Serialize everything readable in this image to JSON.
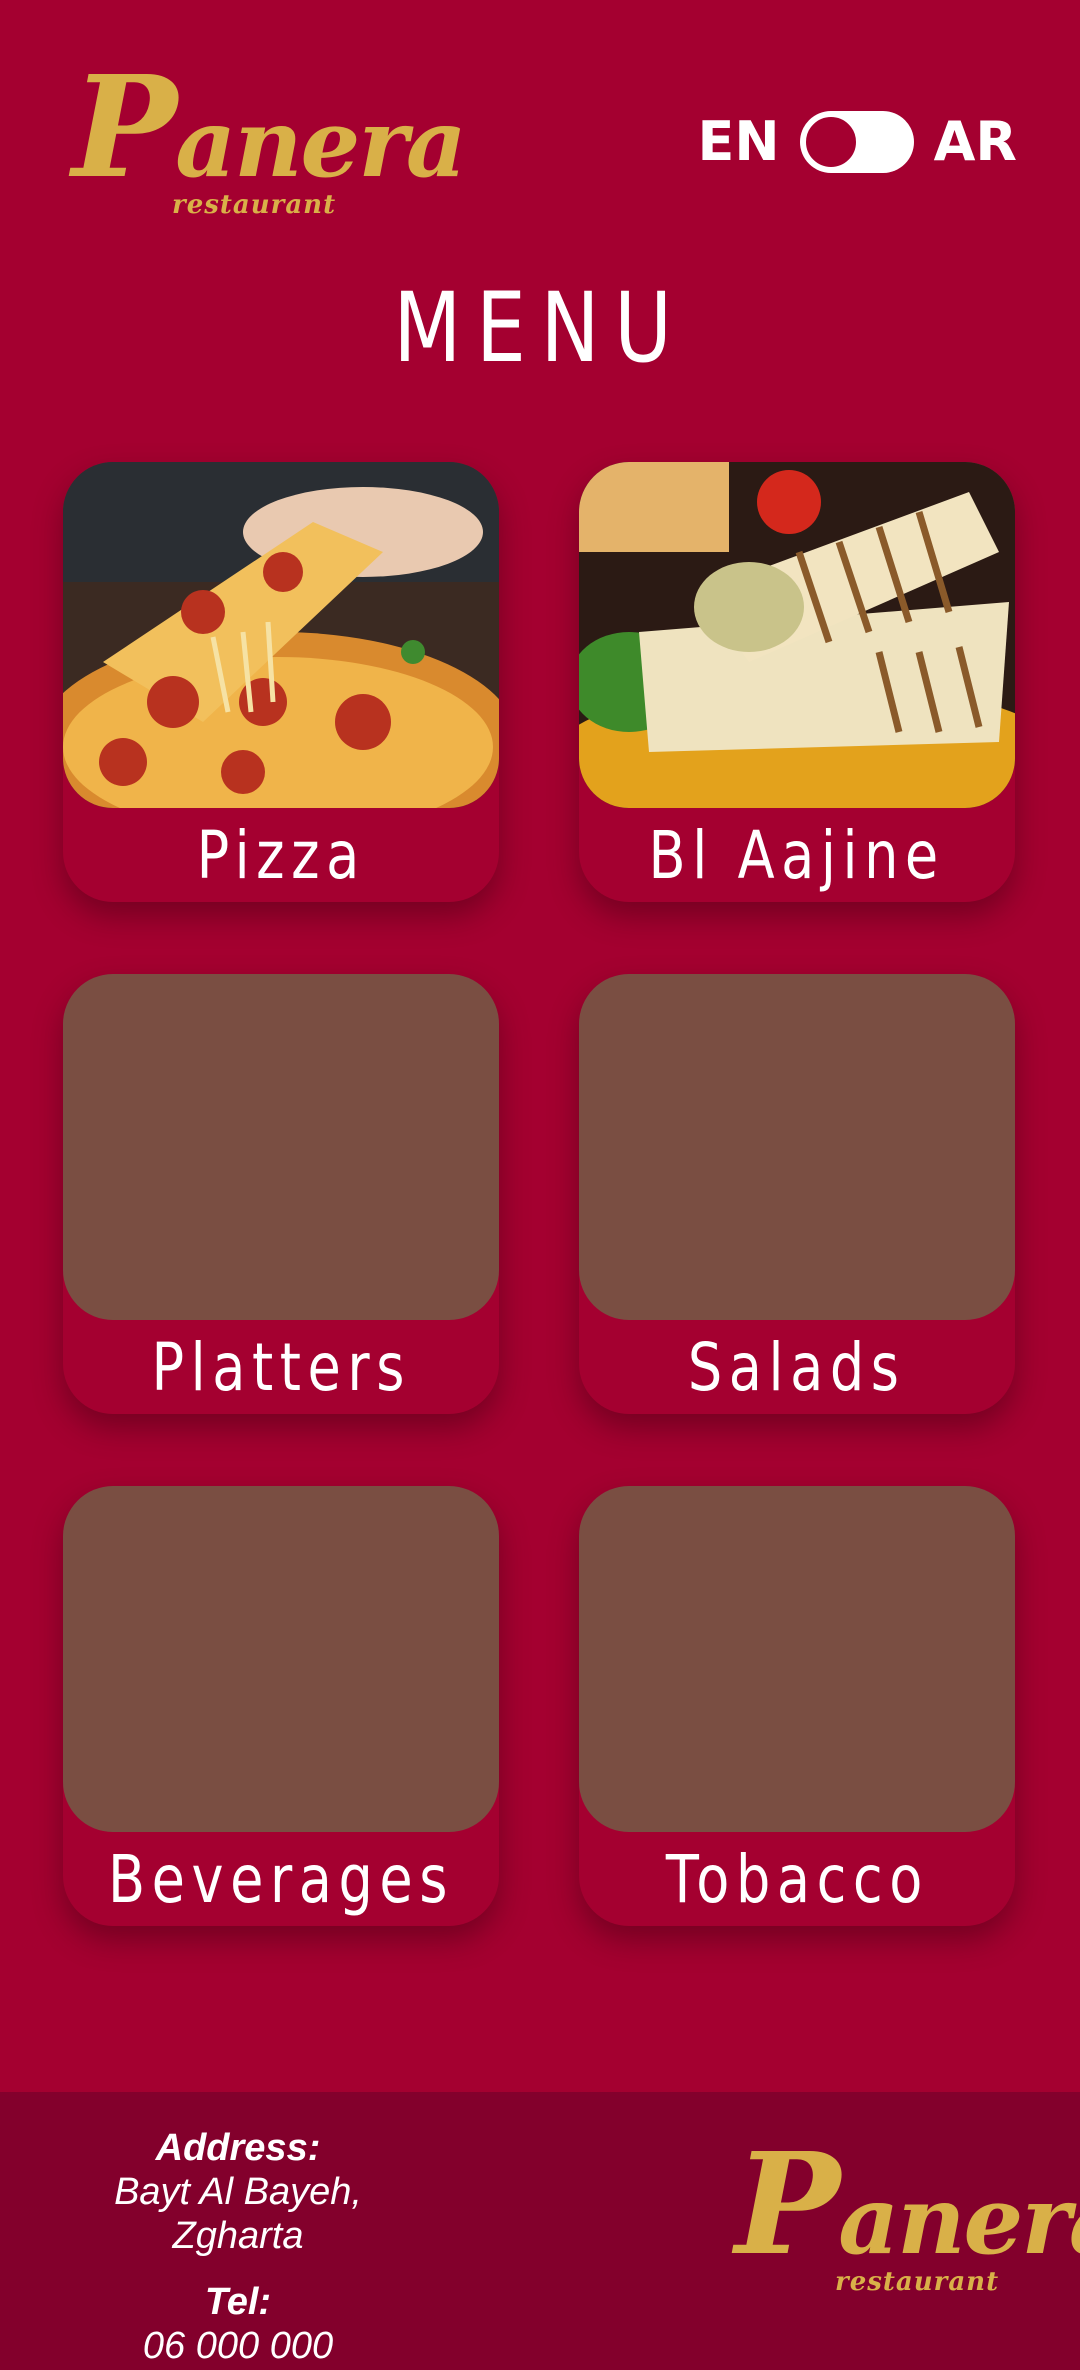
{
  "brand": {
    "name": "Panera",
    "subtitle": "restaurant",
    "color": "#d9b048"
  },
  "language": {
    "left_label": "EN",
    "right_label": "AR",
    "selected": "EN"
  },
  "menu_title": "MENU",
  "categories": [
    {
      "label": "Pizza",
      "image": "pizza-photo"
    },
    {
      "label": "Bl Aajine",
      "image": "wrap-photo"
    },
    {
      "label": "Platters",
      "image": "placeholder"
    },
    {
      "label": "Salads",
      "image": "placeholder"
    },
    {
      "label": "Beverages",
      "image": "placeholder"
    },
    {
      "label": "Tobacco",
      "image": "placeholder"
    }
  ],
  "footer": {
    "address_label": "Address:",
    "address_value": "Bayt Al Bayeh, Zgharta",
    "tel_label": "Tel:",
    "tel_value": "06 000 000"
  },
  "colors": {
    "background": "#a40030",
    "footer_background": "#83002c",
    "placeholder": "#7a4e42",
    "text": "#ffffff"
  }
}
